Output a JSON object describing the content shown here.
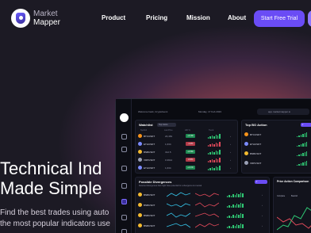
{
  "brand": {
    "line1": "Market",
    "line2": "Mapper"
  },
  "nav": [
    {
      "label": "Product"
    },
    {
      "label": "Pricing"
    },
    {
      "label": "Mission"
    },
    {
      "label": "About"
    }
  ],
  "cta": {
    "label": "Start Free Trial"
  },
  "hero": {
    "title_line1": "Technical Ind",
    "title_line2": "Made Simple",
    "sub_line1": "Find the best trades using auto",
    "sub_line2": "the most popular indicators use"
  },
  "dashboard": {
    "welcome": "Welcome back, CryptoGemi",
    "date": "Monday, 17 Feb 2023",
    "url": "app.marketmapper.io",
    "watchlist": {
      "title": "Watchlist",
      "filter": "Top Coins",
      "rows": [
        {
          "ticker": "BTCUSDT",
          "price": "23,481",
          "change": "+2.4%",
          "dir": "g",
          "color": "#f7931a"
        },
        {
          "ticker": "ETHUSDT",
          "price": "1,634",
          "change": "-1.2%",
          "dir": "r",
          "color": "#7b8bff"
        },
        {
          "ticker": "BNBUSDT",
          "price": "312.5",
          "change": "+0.8%",
          "dir": "g",
          "color": "#f3ba2f"
        },
        {
          "ticker": "XRPUSDT",
          "price": "0.3912",
          "change": "-0.5%",
          "dir": "r",
          "color": "#9aa0b5"
        },
        {
          "ticker": "ETHUSDT",
          "price": "1,634",
          "change": "+1.1%",
          "dir": "g",
          "color": "#7b8bff"
        }
      ]
    },
    "top_bo": {
      "title": "Top BO Action",
      "rows": [
        {
          "ticker": "BTCUSDT",
          "color": "#f7931a"
        },
        {
          "ticker": "ETHUSDT",
          "color": "#7b8bff"
        },
        {
          "ticker": "BNBUSDT",
          "color": "#f3ba2f"
        },
        {
          "ticker": "XRPUSDT",
          "color": "#9aa0b5"
        }
      ]
    },
    "divergence": {
      "title": "Possible Divergences",
      "subtitle": "Detected divergences that might have potential for a divergence & reversal",
      "rows": [
        {
          "ticker": "BNBUSDT",
          "color": "#f3ba2f"
        },
        {
          "ticker": "BNBUSDT",
          "color": "#f3ba2f"
        },
        {
          "ticker": "BNBUSDT",
          "color": "#f3ba2f"
        },
        {
          "ticker": "BNBUSDT",
          "color": "#f3ba2f"
        }
      ]
    },
    "price_action": {
      "title": "Price Action Comparison",
      "legend_a": "Complete",
      "legend_b": "Bearish"
    }
  }
}
